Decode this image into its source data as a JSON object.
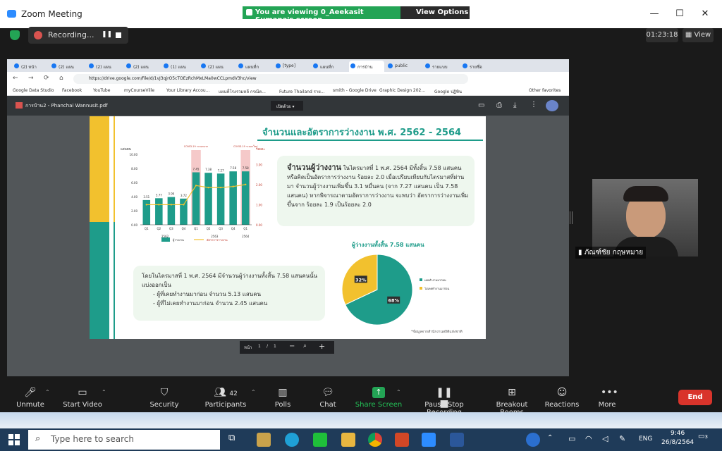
{
  "window": {
    "title": "Zoom Meeting",
    "viewing_banner": "You are viewing 0_Aeekasit Sumana's screen",
    "view_options": "View Options",
    "min_icon": "—",
    "max_icon": "☐",
    "close_icon": "✕"
  },
  "meeting": {
    "recording_label": "Recording...",
    "timer": "01:23:18",
    "view_label": "View"
  },
  "browser": {
    "tabs": [
      "(2) หน้า",
      "(2) แผน",
      "(2) แผน",
      "(2) แผน",
      "(1) แผน",
      "(2) แผน",
      "แผนที่ก",
      "[type]",
      "แผนที่ก",
      "การบ้าน",
      "public",
      "รายแบบ",
      "รายชื่อ"
    ],
    "url": "https://drive.google.com/file/d/1vJ3qjrO5cTOEzRchMxLMa0wCCLpmdV3hc/view",
    "bookmarks": [
      "Google Data Studio",
      "Facebook",
      "YouTube",
      "myCourseVille",
      "Your Library Accou...",
      "แผนที่โรงรวมหลี กรณีต...",
      "Future Thailand ราย...",
      "smith - Google Drive",
      "Graphic Design 202...",
      "Google ปฏิทิน",
      "Other favorites"
    ]
  },
  "pdf": {
    "filename": "การบ้าน2 - Phanchai Wannusit.pdf",
    "zoom_select": "เปิดด้วย",
    "page_label": "หน้า",
    "page_current": "1",
    "page_sep": "/",
    "page_total": "1",
    "minus": "−",
    "plus": "+"
  },
  "slide": {
    "title": "จำนวนและอัตราการว่างงาน พ.ศ. 2562 - 2564",
    "box1_heading": "จำนวนผู้ว่างงาน",
    "box1_text": "ในไตรมาสที่ 1 พ.ศ. 2564 มีทั้งสิ้น 7.58 แสนคน หรือคิดเป็นอัตราการว่างงาน ร้อยละ 2.0 เมื่อเปรียบเทียบกับไตรมาสที่ผ่านมา จำนวนผู้ว่างงานเพิ่มขึ้น 3.1 หมื่นคน (จาก 7.27 แสนคน เป็น 7.58 แสนคน) หากพิจารณาตามอัตราการว่างงาน จะพบว่า อัตราการว่างงานเพิ่มขึ้นจาก ร้อยละ 1.9 เป็นร้อยละ 2.0",
    "box2_line1": "โดยในไตรมาสที่ 1 พ.ศ. 2564 มีจำนวนผู้ว่างงานทั้งสิ้น 7.58 แสนคนนั้น แบ่งออกเป็น",
    "box2_line2": "- ผู้ที่เคยทำงานมาก่อน จำนวน 5.13 แสนคน",
    "box2_line3": "- ผู้ที่ไม่เคยทำงานมาก่อน จำนวน 2.45 แสนคน",
    "pie_title": "ผู้ว่างงานทั้งสิ้น 7.58 แสนคน",
    "source_note": "*ข้อมูลจากสำนักงานสถิติแห่งชาติ",
    "covid_label": "COVID-19 ระลอกแรก",
    "covid_label2": "COVID-19 ระลอกใหม่",
    "y_left_label": "แสนคน",
    "y_right_label": "ร้อยละ"
  },
  "chart_data": [
    {
      "type": "bar",
      "categories": [
        "Q1",
        "Q2",
        "Q3",
        "Q4",
        "Q1",
        "Q2",
        "Q3",
        "Q4",
        "Q1"
      ],
      "year_groups": [
        {
          "label": "2562",
          "span": 4
        },
        {
          "label": "2563",
          "span": 4
        },
        {
          "label": "2564",
          "span": 1
        }
      ],
      "series": [
        {
          "name": "ผู้ว่างงาน",
          "type": "bar",
          "values": [
            3.51,
            3.77,
            3.94,
            3.72,
            7.45,
            7.38,
            7.27,
            7.58,
            7.58
          ]
        },
        {
          "name": "อัตราการว่างงาน",
          "type": "line",
          "values": [
            1.0,
            1.0,
            1.0,
            1.0,
            1.95,
            1.85,
            1.85,
            1.9,
            2.0
          ]
        }
      ],
      "data_labels": [
        "3.51",
        "3.77",
        "3.94",
        "3.72",
        "7.45",
        "7.38",
        "7.27",
        "7.58",
        "7.58"
      ],
      "ylim": [
        0,
        10
      ],
      "yticks": [
        "0.00",
        "2.00",
        "4.00",
        "6.00",
        "8.00",
        "10.00"
      ],
      "y2ticks": [
        "0.00",
        "1.00",
        "2.00",
        "3.00"
      ],
      "y2lim": [
        0,
        3.5
      ],
      "colors": {
        "bar": "#1e9c8a",
        "line": "#f2c12e",
        "highlight": "#f5c9c9"
      }
    },
    {
      "type": "pie",
      "labels": [
        "เคยทำงานมาก่อน",
        "ไม่เคยทำงานมาก่อน"
      ],
      "values": [
        68,
        32
      ],
      "value_labels": [
        "68%",
        "32%"
      ],
      "colors": [
        "#1e9c8a",
        "#f2c12e"
      ]
    }
  ],
  "participant": {
    "name": "ภัณฑ์ชัย กฤษหมาย"
  },
  "toolbar": {
    "unmute": "Unmute",
    "start_video": "Start Video",
    "security": "Security",
    "participants": "Participants",
    "participants_count": "42",
    "polls": "Polls",
    "chat": "Chat",
    "share_screen": "Share Screen",
    "pause_recording": "Pause/Stop Recording",
    "breakout": "Breakout Rooms",
    "reactions": "Reactions",
    "more": "More",
    "end": "End"
  },
  "taskbar": {
    "search_placeholder": "Type here to search",
    "lang": "ENG",
    "time": "9:46",
    "date": "26/8/2564",
    "notif_count": "3"
  }
}
